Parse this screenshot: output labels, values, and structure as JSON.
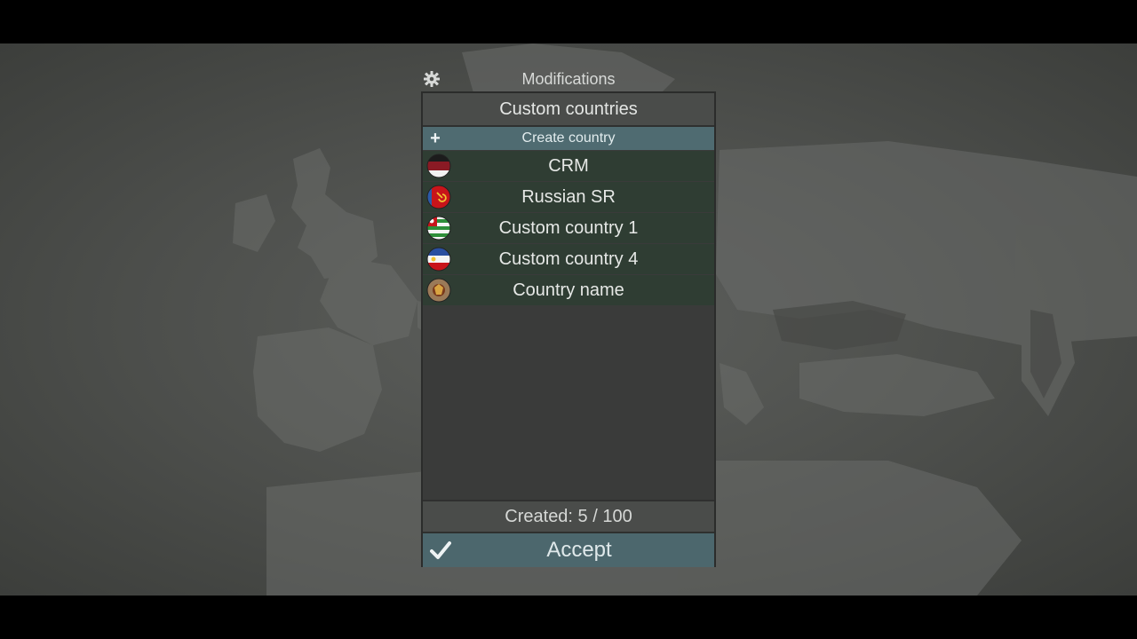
{
  "header": {
    "title": "Modifications"
  },
  "panel": {
    "title": "Custom countries",
    "create_label": "Create country",
    "countries": [
      {
        "name": "CRM",
        "flag": "crm-flag-icon"
      },
      {
        "name": "Russian SR",
        "flag": "russian-sr-flag-icon"
      },
      {
        "name": "Custom country 1",
        "flag": "custom-country-1-flag-icon"
      },
      {
        "name": "Custom country 4",
        "flag": "custom-country-4-flag-icon"
      },
      {
        "name": "Country name",
        "flag": "country-name-flag-icon"
      }
    ],
    "created_label": "Created: 5 / 100",
    "accept_label": "Accept"
  },
  "colors": {
    "accent_button": "#4f6b71",
    "list_row": "#2f3d33",
    "panel_bg": "#3a3b3a"
  }
}
